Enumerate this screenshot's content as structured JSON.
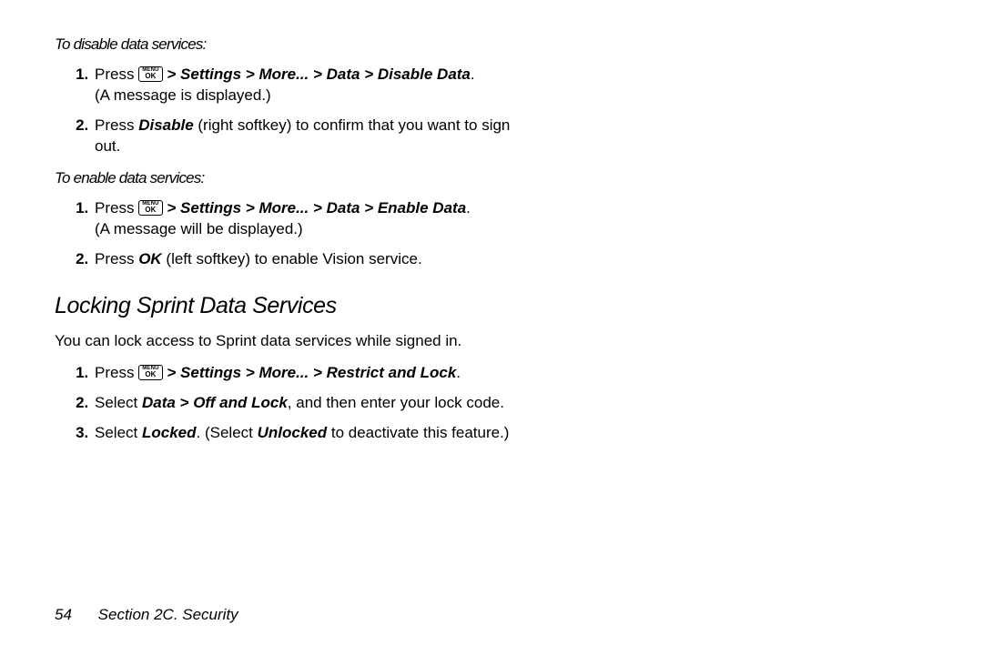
{
  "disable": {
    "heading": "To disable data services:",
    "step1_press": "Press ",
    "step1_path": " > Settings > More... > Data > Disable Data",
    "step1_period": ".",
    "step1_result": "(A message is displayed.)",
    "step2_a": "Press ",
    "step2_b": "Disable",
    "step2_c": " (right softkey) to confirm that you want to sign out."
  },
  "enable": {
    "heading": "To enable data services:",
    "step1_press": "Press ",
    "step1_path": " > Settings > More... > Data > Enable Data",
    "step1_period": ".",
    "step1_result": "(A message will be displayed.)",
    "step2_a": "Press ",
    "step2_b": "OK",
    "step2_c": " (left softkey) to enable Vision service."
  },
  "locking": {
    "title": "Locking Sprint Data Services",
    "intro": "You can lock access to Sprint data services while signed in.",
    "step1_press": "Press ",
    "step1_path": " > Settings > More... > Restrict and Lock",
    "step1_period": ".",
    "step2_a": "Select ",
    "step2_b": "Data > Off and Lock",
    "step2_c": ", and then enter your lock code.",
    "step3_a": "Select ",
    "step3_b": "Locked",
    "step3_c": ". (Select ",
    "step3_d": "Unlocked",
    "step3_e": " to deactivate this feature.)"
  },
  "key": {
    "menu": "MENU",
    "ok": "OK"
  },
  "footer": {
    "page": "54",
    "section": "Section 2C. Security"
  }
}
